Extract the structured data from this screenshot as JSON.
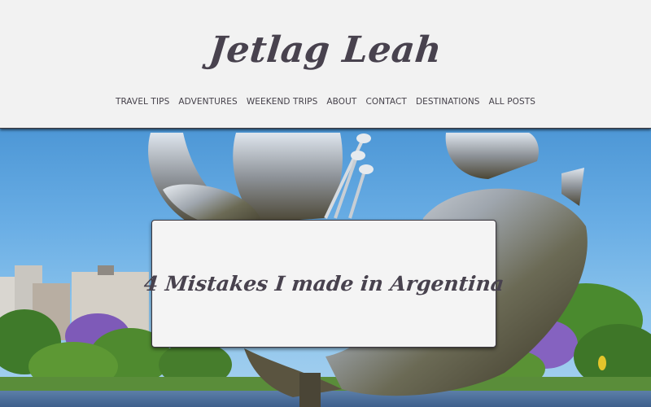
{
  "site": {
    "logo_text": "Jetlag Leah"
  },
  "nav": {
    "items": [
      {
        "label": "TRAVEL TIPS"
      },
      {
        "label": "ADVENTURES"
      },
      {
        "label": "WEEKEND TRIPS"
      },
      {
        "label": "ABOUT"
      },
      {
        "label": "CONTACT"
      },
      {
        "label": "DESTINATIONS"
      },
      {
        "label": "ALL POSTS"
      }
    ]
  },
  "hero": {
    "post_title": "4 Mistakes I made in Argentina",
    "image_subject": "metal-flower-sculpture-photo"
  },
  "colors": {
    "header_bg": "#f2f2f2",
    "text": "#48424e",
    "sky": "#6aaee5"
  }
}
